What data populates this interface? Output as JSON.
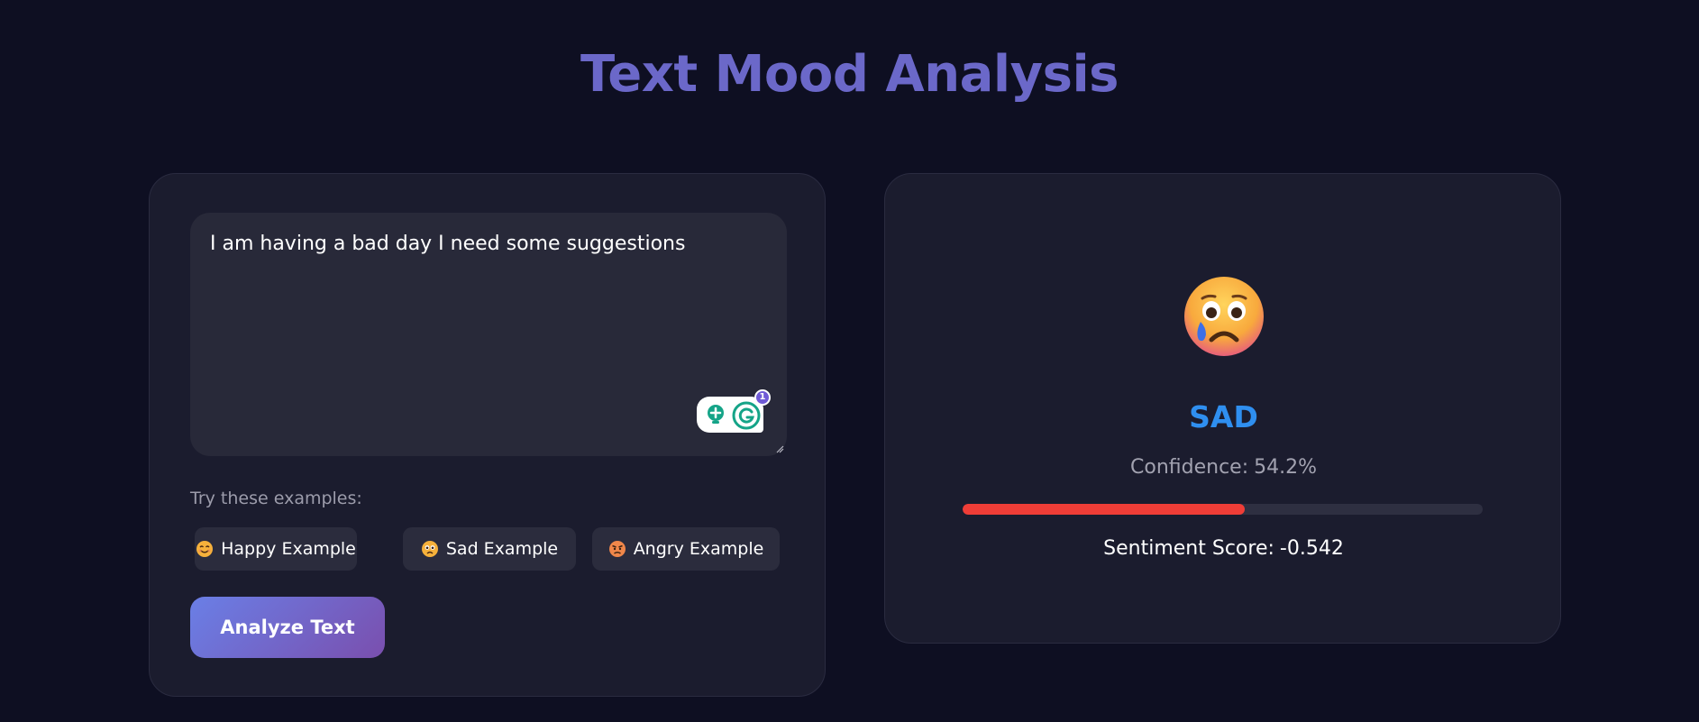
{
  "header": {
    "title": "Text Mood Analysis"
  },
  "input_panel": {
    "text_value": "I am having a bad day I need some suggestions",
    "grammar_badge_count": "1",
    "examples_label": "Try these examples:",
    "examples": [
      {
        "label": "Happy Example",
        "icon": "smiling-face-icon"
      },
      {
        "label": "Sad Example",
        "icon": "crying-face-icon"
      },
      {
        "label": "Angry Example",
        "icon": "angry-face-icon"
      }
    ],
    "analyze_label": "Analyze Text"
  },
  "result_panel": {
    "emoji_icon": "sad-tear-face-icon",
    "mood": "SAD",
    "mood_color": "#2f8ff0",
    "confidence_prefix": "Confidence:",
    "confidence_value": "54.2%",
    "confidence_fraction": 0.542,
    "bar_color": "#ef3d37",
    "score_prefix": "Sentiment Score:",
    "score_value": "-0.542"
  },
  "colors": {
    "background": "#0e0f22",
    "card": "#1b1c2e",
    "title": "#6b68c9",
    "button_gradient_start": "#6a7fe6",
    "button_gradient_end": "#7a4fae"
  }
}
